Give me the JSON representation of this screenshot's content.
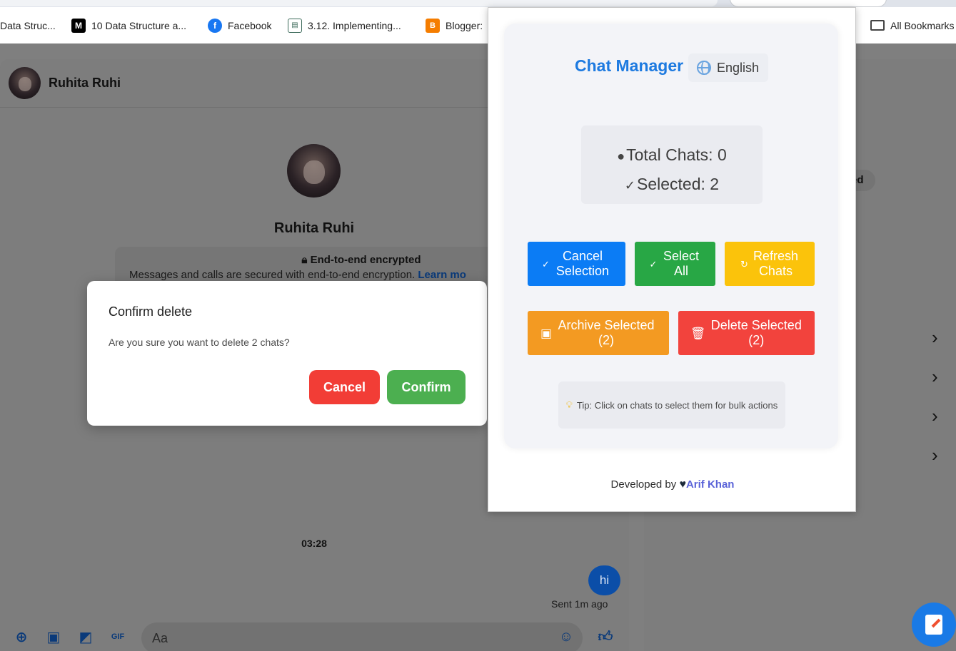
{
  "bookmarks": [
    {
      "label": "Data Struc...",
      "icon": "page-icon"
    },
    {
      "label": "10 Data Structure a...",
      "icon": "medium-icon"
    },
    {
      "label": "Facebook",
      "icon": "facebook-icon"
    },
    {
      "label": "3.12. Implementing...",
      "icon": "book-icon"
    },
    {
      "label": "Blogger:",
      "icon": "blogger-icon"
    },
    {
      "label": "All Bookmarks",
      "icon": "folder-icon"
    }
  ],
  "chat": {
    "contact_name": "Ruhita Ruhi",
    "profile_name": "Ruhita Ruhi",
    "e2e_title": "End-to-end encrypted",
    "e2e_text": "Messages and calls are secured with end-to-end encryption.",
    "e2e_link": "Learn mo",
    "timestamp": "03:28",
    "message": "hi",
    "sent_status": "Sent 1m ago",
    "input_placeholder": "Aa",
    "status_chip": "ed"
  },
  "modal": {
    "title": "Confirm delete",
    "message": "Are you sure you want to delete 2 chats?",
    "cancel_label": "Cancel",
    "confirm_label": "Confirm"
  },
  "popup": {
    "title": "Chat Manager",
    "language": "English",
    "total_chats": "Total Chats: 0",
    "selected": "Selected: 2",
    "cancel_selection": "Cancel Selection",
    "select_all": "Select All",
    "refresh_chats": "Refresh Chats",
    "archive_selected": "Archive Selected (2)",
    "delete_selected": "Delete Selected (2)",
    "tip": "Tip: Click on chats to select them for bulk actions",
    "footer_prefix": "Developed by",
    "developer": "Arif Khan"
  },
  "colors": {
    "accent_blue": "#0b7cf5",
    "green": "#28a745",
    "yellow": "#fbc30b",
    "orange": "#f39a22",
    "red": "#f2433d"
  }
}
